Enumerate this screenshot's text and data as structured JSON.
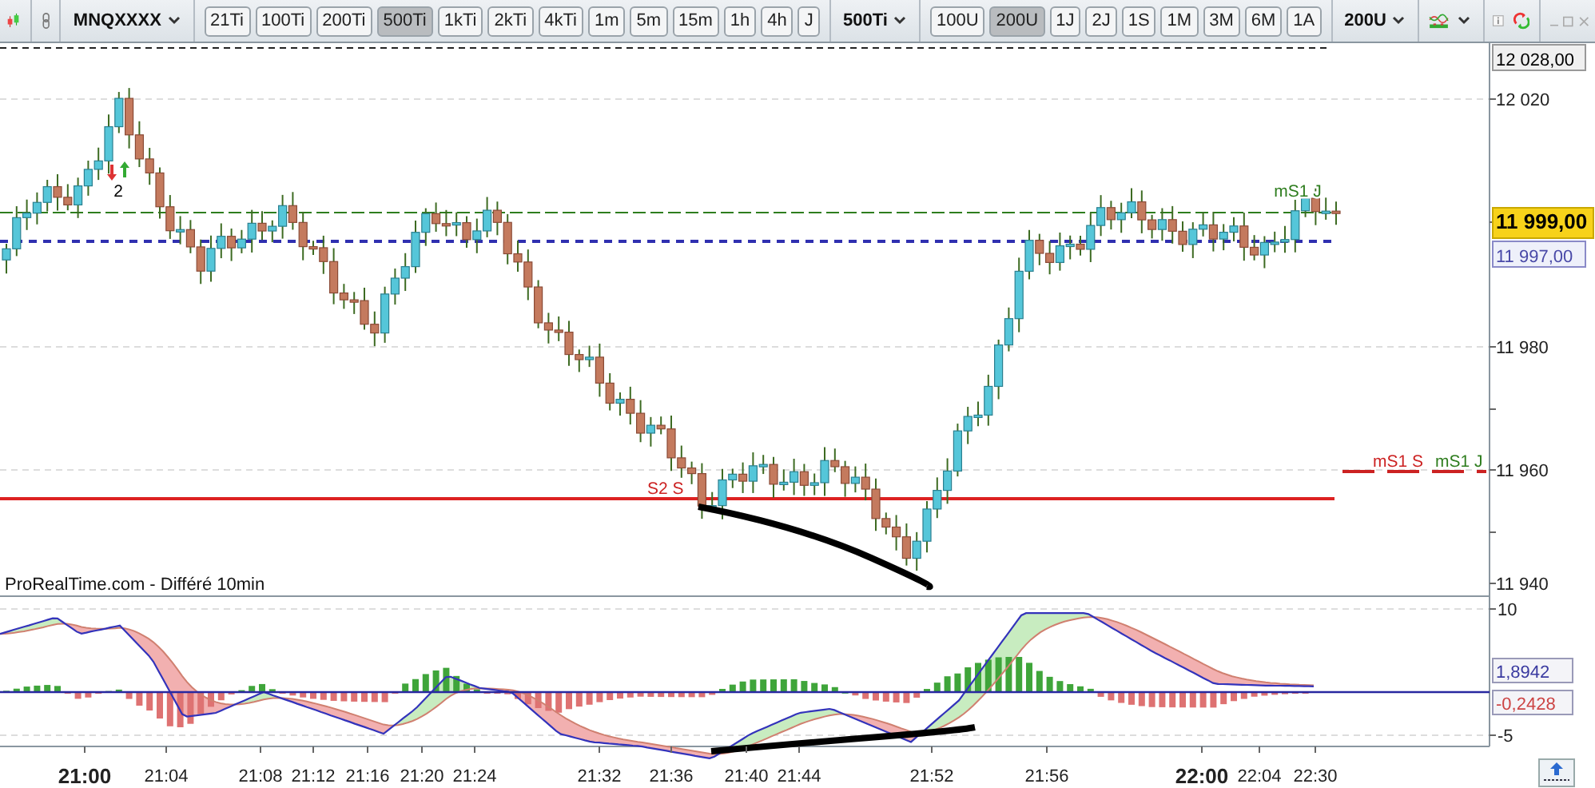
{
  "toolbar": {
    "symbol": "MNQXXXX",
    "tick_buttons": [
      {
        "label": "21Ti",
        "selected": false
      },
      {
        "label": "100Ti",
        "selected": false
      },
      {
        "label": "200Ti",
        "selected": false
      },
      {
        "label": "500Ti",
        "selected": true
      },
      {
        "label": "1kTi",
        "selected": false
      },
      {
        "label": "2kTi",
        "selected": false
      },
      {
        "label": "4kTi",
        "selected": false
      },
      {
        "label": "1m",
        "selected": false
      },
      {
        "label": "5m",
        "selected": false
      },
      {
        "label": "15m",
        "selected": false
      },
      {
        "label": "1h",
        "selected": false
      },
      {
        "label": "4h",
        "selected": false
      },
      {
        "label": "J",
        "selected": false
      }
    ],
    "tick_dropdown": "500Ti",
    "unit_buttons": [
      {
        "label": "100U",
        "selected": false
      },
      {
        "label": "200U",
        "selected": true
      },
      {
        "label": "1J",
        "selected": false
      },
      {
        "label": "2J",
        "selected": false
      },
      {
        "label": "1S",
        "selected": false
      },
      {
        "label": "1M",
        "selected": false
      },
      {
        "label": "3M",
        "selected": false
      },
      {
        "label": "6M",
        "selected": false
      },
      {
        "label": "1A",
        "selected": false
      }
    ],
    "unit_dropdown": "200U"
  },
  "chart": {
    "annotations": [
      {
        "text": "2",
        "color": "#000000"
      },
      {
        "text": "mS1 J",
        "color": "#2e7d1e"
      },
      {
        "text": "S2 S",
        "color": "#cc2222"
      },
      {
        "text": "mS1 S",
        "color": "#cc2222"
      },
      {
        "text": "mS1 J",
        "color": "#2e7d1e"
      }
    ],
    "price_ticks": [
      "12 020",
      "11 980",
      "11 960",
      "11 940"
    ],
    "price_tags": [
      {
        "text": "12 028,00",
        "kind": "plain",
        "color": "#000000"
      },
      {
        "text": "11 999,00",
        "kind": "last",
        "color": "#000000"
      },
      {
        "text": "11 997,00",
        "kind": "line",
        "color": "#4a4aa8"
      }
    ],
    "source_note": "ProRealTime.com - Différé 10min"
  },
  "indicator": {
    "ticks": [
      "10",
      "-5"
    ],
    "value_tags": [
      {
        "text": "1,8942",
        "color": "#3a3aa0"
      },
      {
        "text": "-0,2428",
        "color": "#cc4444"
      }
    ]
  },
  "time_axis": [
    {
      "label": "21:00",
      "emphasized": true
    },
    {
      "label": "21:04",
      "emphasized": false
    },
    {
      "label": "21:08",
      "emphasized": false
    },
    {
      "label": "21:12",
      "emphasized": false
    },
    {
      "label": "21:16",
      "emphasized": false
    },
    {
      "label": "21:20",
      "emphasized": false
    },
    {
      "label": "21:24",
      "emphasized": false
    },
    {
      "label": "21:32",
      "emphasized": false
    },
    {
      "label": "21:36",
      "emphasized": false
    },
    {
      "label": "21:40",
      "emphasized": false
    },
    {
      "label": "21:44",
      "emphasized": false
    },
    {
      "label": "21:52",
      "emphasized": false
    },
    {
      "label": "21:56",
      "emphasized": false
    },
    {
      "label": "22:00",
      "emphasized": true
    },
    {
      "label": "22:04",
      "emphasized": false
    },
    {
      "label": "22:30",
      "emphasized": false
    }
  ]
}
